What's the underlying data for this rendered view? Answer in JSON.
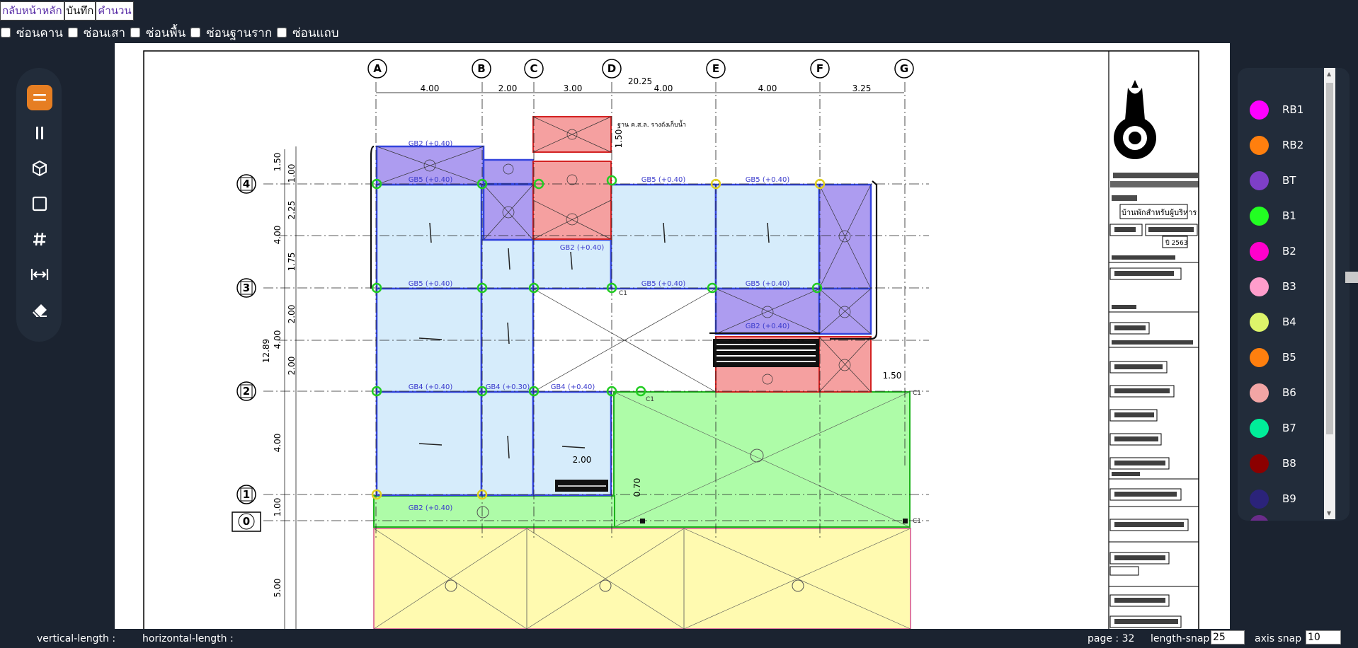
{
  "nav": {
    "home": "กลับหน้าหลัก",
    "save": "บันทึก",
    "calc": "คำนวน"
  },
  "checks": [
    "ซ่อนคาน",
    "ซ่อนเสา",
    "ซ่อนพื้น",
    "ซ่อนฐานราก",
    "ซ่อนแถบ"
  ],
  "tools": [
    "beam-tool",
    "column-tool",
    "box-3d-tool",
    "slab-tool",
    "grid-tool",
    "dimension-tool",
    "eraser-tool"
  ],
  "legend": [
    {
      "label": "RB1",
      "color": "#ff00ff"
    },
    {
      "label": "RB2",
      "color": "#ff7f0e"
    },
    {
      "label": "BT",
      "color": "#7e3fc7"
    },
    {
      "label": "B1",
      "color": "#22ff22"
    },
    {
      "label": "B2",
      "color": "#ff00cc"
    },
    {
      "label": "B3",
      "color": "#ff9dcb"
    },
    {
      "label": "B4",
      "color": "#ddf46a"
    },
    {
      "label": "B5",
      "color": "#ff7f0e"
    },
    {
      "label": "B6",
      "color": "#f2a5a5"
    },
    {
      "label": "B7",
      "color": "#00ee99"
    },
    {
      "label": "B8",
      "color": "#8b0000"
    },
    {
      "label": "B9",
      "color": "#2b237a"
    }
  ],
  "drawing": {
    "grid_x": [
      "A",
      "B",
      "C",
      "D",
      "E",
      "F",
      "G"
    ],
    "grid_y": [
      "4",
      "3",
      "2",
      "1",
      "0"
    ],
    "total_width": "20.25",
    "spans": [
      "4.00",
      "2.00",
      "3.00",
      "4.00",
      "4.00",
      "3.25"
    ],
    "left_dims": [
      "1.50",
      "1.00",
      "2.25",
      "1.75",
      "2.00",
      "2.00",
      "4.00",
      "1.00",
      "5.00"
    ],
    "left_group": [
      "4.00",
      "4.00",
      "12.89"
    ],
    "note": "ฐาน ค.ส.ล. รางถังเก็บน้ำ",
    "gb_labels": [
      "GB2 (+0.40)",
      "GB5 (+0.40)",
      "GB4 (+0.40)",
      "GB4 (+0.30)",
      "GB2 (+0.40)"
    ],
    "extra_dims": [
      "1.50",
      "2.00",
      "0.70",
      "1.50"
    ],
    "col": "C1"
  },
  "titleblock": [
    "โครงการ",
    "บ้านพักสำหรับผู้บริหาร",
    "ปี 2563"
  ],
  "status": {
    "vertical": "vertical-length :",
    "horizontal": "horizontal-length :",
    "page": "page : 32",
    "length_snap_label": "length-snap :",
    "length_snap_value": "25",
    "axis_snap_label": "axis snap :",
    "axis_snap_value": "10"
  }
}
